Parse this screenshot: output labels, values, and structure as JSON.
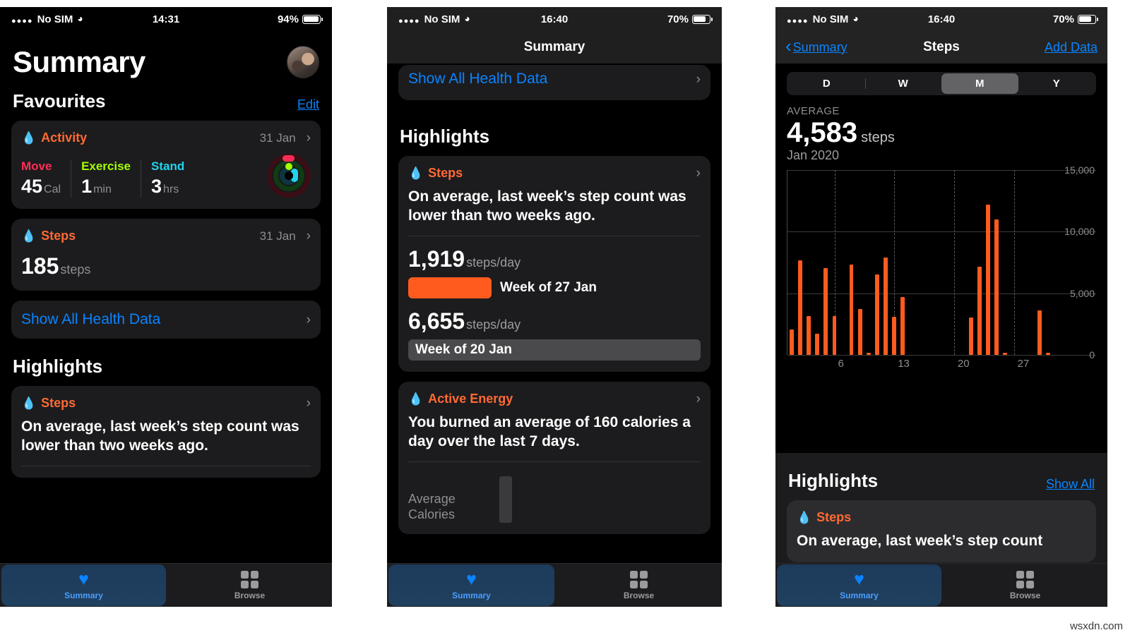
{
  "watermark": "wsxdn.com",
  "panel1": {
    "status": {
      "carrier": "No SIM",
      "time": "14:31",
      "battery": "94%"
    },
    "page_title": "Summary",
    "favourites_header": "Favourites",
    "edit_link": "Edit",
    "activity_card": {
      "title": "Activity",
      "date": "31 Jan",
      "metrics": [
        {
          "label": "Move",
          "value": "45",
          "unit": "Cal"
        },
        {
          "label": "Exercise",
          "value": "1",
          "unit": "min"
        },
        {
          "label": "Stand",
          "value": "3",
          "unit": "hrs"
        }
      ]
    },
    "steps_card": {
      "title": "Steps",
      "date": "31 Jan",
      "value": "185",
      "unit": "steps"
    },
    "show_all_health_data": "Show All Health Data",
    "highlights_header": "Highlights",
    "highlight_card": {
      "title": "Steps",
      "text": "On average, last week’s step count was lower than two weeks ago."
    },
    "tabs": [
      {
        "label": "Summary",
        "icon": "heart-icon",
        "active": true
      },
      {
        "label": "Browse",
        "icon": "grid-icon",
        "active": false
      }
    ]
  },
  "panel2": {
    "status": {
      "carrier": "No SIM",
      "time": "16:40",
      "battery": "70%"
    },
    "nav_title": "Summary",
    "show_all_health_data": "Show All Health Data",
    "highlights_header": "Highlights",
    "steps_card": {
      "title": "Steps",
      "text": "On average, last week’s step count was lower than two weeks ago.",
      "compare": [
        {
          "value": "1,919",
          "unit": "steps/day",
          "label": "Week of 27 Jan",
          "color": "#ff5b1f"
        },
        {
          "value": "6,655",
          "unit": "steps/day",
          "label": "Week of 20 Jan",
          "color": "#4a4a4c"
        }
      ]
    },
    "active_energy_card": {
      "title": "Active Energy",
      "text": "You burned an average of 160 calories a day over the last 7 days.",
      "axis_label_line1": "Average",
      "axis_label_line2": "Calories"
    },
    "tabs": [
      {
        "label": "Summary",
        "icon": "heart-icon",
        "active": true
      },
      {
        "label": "Browse",
        "icon": "grid-icon",
        "active": false
      }
    ]
  },
  "panel3": {
    "status": {
      "carrier": "No SIM",
      "time": "16:40",
      "battery": "70%"
    },
    "back_label": "Summary",
    "nav_title": "Steps",
    "add_data_link": "Add Data",
    "segments": [
      "D",
      "W",
      "M",
      "Y"
    ],
    "active_segment": "M",
    "average_label": "AVERAGE",
    "average_value": "4,583",
    "average_unit": "steps",
    "period": "Jan 2020",
    "highlights_header": "Highlights",
    "show_all_link": "Show All",
    "highlight_card": {
      "title": "Steps",
      "text": "On average, last week’s step count"
    },
    "tabs": [
      {
        "label": "Summary",
        "icon": "heart-icon",
        "active": true
      },
      {
        "label": "Browse",
        "icon": "grid-icon",
        "active": false
      }
    ]
  },
  "chart_data": {
    "type": "bar",
    "title": "Steps",
    "subtitle": "Jan 2020",
    "xlabel": "",
    "ylabel": "steps",
    "ylim": [
      0,
      15000
    ],
    "yticks": [
      0,
      5000,
      10000,
      15000
    ],
    "ytick_labels": [
      "0",
      "5,000",
      "10,000",
      "15,000"
    ],
    "xticks": [
      6,
      13,
      20,
      27
    ],
    "xtick_labels": [
      "6",
      "13",
      "20",
      "27"
    ],
    "grid": true,
    "bar_color": "#ff5b1f",
    "categories": [
      1,
      2,
      3,
      4,
      5,
      6,
      7,
      8,
      9,
      10,
      11,
      12,
      13,
      14,
      15,
      16,
      17,
      18,
      19,
      20,
      21,
      22,
      23,
      24,
      25,
      26,
      27,
      28,
      29,
      30,
      31
    ],
    "values": [
      2050,
      7650,
      3150,
      1700,
      7050,
      3150,
      0,
      7350,
      3700,
      120,
      6500,
      7900,
      3100,
      4700,
      0,
      0,
      0,
      0,
      0,
      0,
      0,
      3050,
      7150,
      12200,
      11000,
      120,
      0,
      0,
      0,
      3600,
      180
    ],
    "average": 4583,
    "average_label": "AVERAGE"
  }
}
